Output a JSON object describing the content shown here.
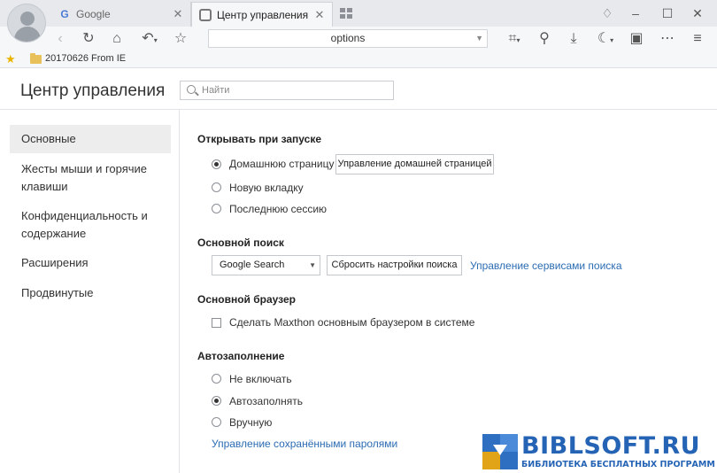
{
  "tabs": [
    {
      "label": "Google",
      "active": false
    },
    {
      "label": "Центр управления",
      "active": true
    }
  ],
  "address": {
    "value": "options"
  },
  "bookmarks": [
    {
      "label": "20170626 From IE"
    }
  ],
  "page": {
    "title": "Центр управления"
  },
  "search": {
    "placeholder": "Найти",
    "value": ""
  },
  "sidebar": {
    "items": [
      {
        "label": "Основные",
        "active": true
      },
      {
        "label": "Жесты мыши и горячие клавиши",
        "line1": "Жесты мыши и горячие",
        "line2": "клавиши"
      },
      {
        "label": "Конфиденциальность и содержание",
        "line1": "Конфиденциальность и",
        "line2": "содержание"
      },
      {
        "label": "Расширения"
      },
      {
        "label": "Продвинутые"
      }
    ]
  },
  "startup": {
    "title": "Открывать при запуске",
    "options": [
      {
        "label": "Домашнюю страницу",
        "selected": true
      },
      {
        "label": "Новую вкладку",
        "selected": false
      },
      {
        "label": "Последнюю сессию",
        "selected": false
      }
    ],
    "manage_home_button": "Управление домашней страницей"
  },
  "search_engine": {
    "title": "Основной поиск",
    "selected": "Google Search",
    "reset_button": "Сбросить настройки поиска",
    "manage_link": "Управление сервисами поиска"
  },
  "default_browser": {
    "title": "Основной браузер",
    "checkbox_label": "Сделать Maxthon основным браузером в системе",
    "checked": false
  },
  "autofill": {
    "title": "Автозаполнение",
    "options": [
      {
        "label": "Не включать",
        "selected": false
      },
      {
        "label": "Автозаполнять",
        "selected": true
      },
      {
        "label": "Вручную",
        "selected": false
      }
    ],
    "manage_passwords_link": "Управление сохранёнными паролями"
  },
  "watermark": {
    "title": "BIBLSOFT.RU",
    "subtitle": "БИБЛИОТЕКА БЕСПЛАТНЫХ ПРОГРАММ"
  },
  "colors": {
    "accent_link": "#2b6cb3",
    "watermark": "#2563b5"
  }
}
